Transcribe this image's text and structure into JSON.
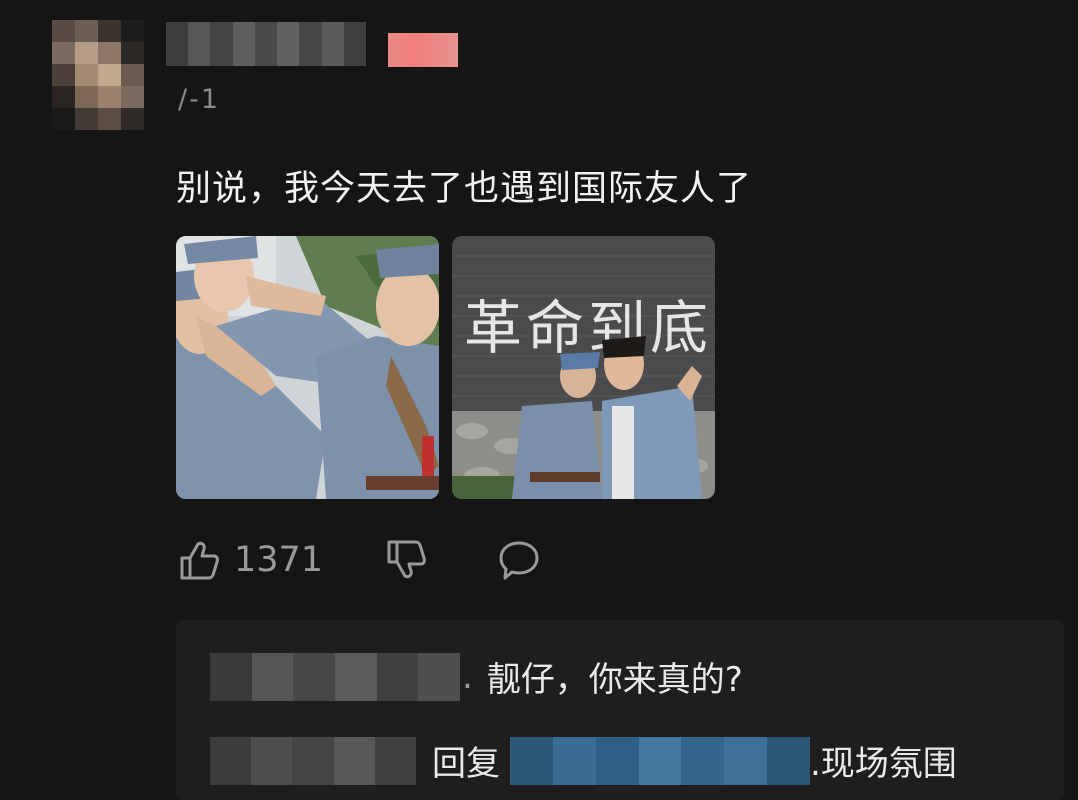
{
  "comment": {
    "meta_text": "/-1",
    "text": "别说，我今天去了也遇到国际友人了",
    "images": [
      {
        "subject": "soldiers-saluting-photo"
      },
      {
        "subject": "two-men-before-slogan-wall-photo",
        "wall_text": "革命到底"
      }
    ],
    "like_count": "1371"
  },
  "replies": [
    {
      "name_suffix": ".",
      "text": "靓仔，你来真的?"
    },
    {
      "prefix": "回复",
      "text": ".现场氛围"
    }
  ],
  "icons": {
    "like": "thumbs-up-icon",
    "dislike": "thumbs-down-icon",
    "reply": "speech-bubble-icon"
  },
  "colors": {
    "background": "#151515",
    "reply_panel": "#1e1e1e",
    "badge": "#f07d7a",
    "uniform_blue": "#7f93ad"
  }
}
